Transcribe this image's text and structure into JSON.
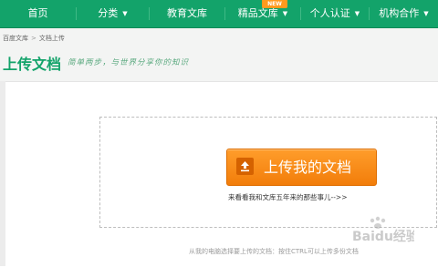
{
  "nav": {
    "items": [
      {
        "label": "首页",
        "caret": false
      },
      {
        "label": "分类",
        "caret": true
      },
      {
        "label": "教育文库",
        "caret": false
      },
      {
        "label": "精品文库",
        "caret": true
      },
      {
        "label": "个人认证",
        "caret": true
      },
      {
        "label": "机构合作",
        "caret": true
      }
    ],
    "new_badge": "NEW"
  },
  "breadcrumb": {
    "home": "百度文库",
    "separator": ">",
    "current": "文档上传"
  },
  "page": {
    "title": "上传文档",
    "slogan": "简单两步，与世界分享你的知识"
  },
  "upload": {
    "button_label": "上传我的文档",
    "history_link": "来看看我和文库五年来的那些事儿-->>",
    "help_text": "从我的电脑选择要上传的文档：按住CTRL可以上传多份文档"
  },
  "watermark": {
    "text": "Baidu经验"
  },
  "colors": {
    "nav_bg": "#13a36a",
    "title_green": "#13a36a",
    "button_orange": "#f58a14",
    "badge_orange": "#ff9a1e"
  }
}
